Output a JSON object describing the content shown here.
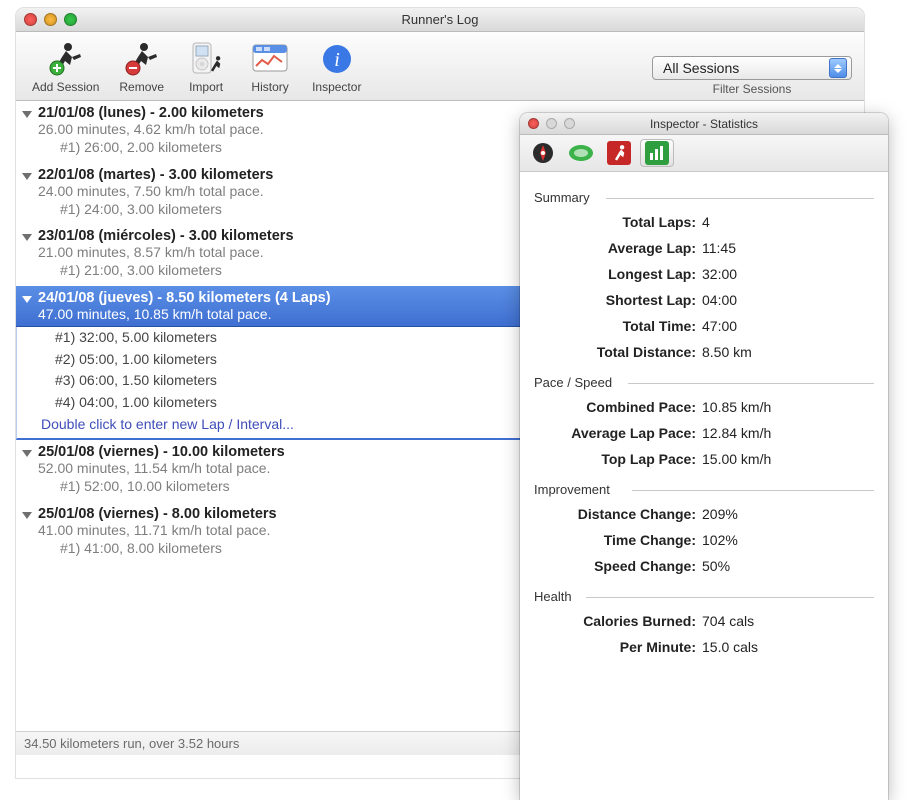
{
  "window": {
    "title": "Runner's Log"
  },
  "toolbar": {
    "add_session": "Add Session",
    "remove": "Remove",
    "import": "Import",
    "history": "History",
    "inspector": "Inspector"
  },
  "filter": {
    "selected": "All Sessions",
    "label": "Filter Sessions"
  },
  "sessions": [
    {
      "title": "21/01/08 (lunes) - 2.00 kilometers",
      "sub": "26.00 minutes, 4.62 km/h total pace.",
      "laps": [
        "#1) 26:00, 2.00 kilometers"
      ]
    },
    {
      "title": "22/01/08 (martes) - 3.00 kilometers",
      "sub": "24.00 minutes, 7.50 km/h total pace.",
      "laps": [
        "#1) 24:00, 3.00 kilometers"
      ]
    },
    {
      "title": "23/01/08 (miércoles) - 3.00 kilometers",
      "sub": "21.00 minutes, 8.57 km/h total pace.",
      "laps": [
        "#1) 21:00, 3.00 kilometers"
      ]
    },
    {
      "title": "24/01/08 (jueves) - 8.50 kilometers (4 Laps)",
      "sub": "47.00 minutes, 10.85 km/h total pace.",
      "laps": [
        "#1) 32:00, 5.00 kilometers",
        "#2) 05:00, 1.00 kilometers",
        "#3) 06:00, 1.50 kilometers",
        "#4) 04:00, 1.00 kilometers"
      ],
      "selected": true,
      "new_lap_hint": "Double click to enter new Lap / Interval..."
    },
    {
      "title": "25/01/08 (viernes) - 10.00 kilometers",
      "sub": "52.00 minutes, 11.54 km/h total pace.",
      "laps": [
        "#1) 52:00, 10.00 kilometers"
      ]
    },
    {
      "title": "25/01/08 (viernes) - 8.00 kilometers",
      "sub": "41.00 minutes, 11.71 km/h total pace.",
      "laps": [
        "#1) 41:00, 8.00 kilometers"
      ]
    }
  ],
  "status_bar": "34.50 kilometers run, over 3.52 hours",
  "inspector": {
    "title": "Inspector - Statistics",
    "groups": {
      "summary_label": "Summary",
      "pace_label": "Pace / Speed",
      "improvement_label": "Improvement",
      "health_label": "Health"
    },
    "stats": {
      "total_laps_label": "Total Laps:",
      "total_laps": "4",
      "avg_lap_label": "Average Lap:",
      "avg_lap": "11:45",
      "longest_lap_label": "Longest Lap:",
      "longest_lap": "32:00",
      "shortest_lap_label": "Shortest Lap:",
      "shortest_lap": "04:00",
      "total_time_label": "Total Time:",
      "total_time": "47:00",
      "total_distance_label": "Total Distance:",
      "total_distance": "8.50 km",
      "combined_pace_label": "Combined Pace:",
      "combined_pace": "10.85 km/h",
      "avg_lap_pace_label": "Average Lap Pace:",
      "avg_lap_pace": "12.84 km/h",
      "top_lap_pace_label": "Top Lap Pace:",
      "top_lap_pace": "15.00 km/h",
      "distance_change_label": "Distance Change:",
      "distance_change": "209%",
      "time_change_label": "Time Change:",
      "time_change": "102%",
      "speed_change_label": "Speed Change:",
      "speed_change": "50%",
      "calories_label": "Calories Burned:",
      "calories": "704 cals",
      "per_minute_label": "Per Minute:",
      "per_minute": "15.0 cals"
    }
  }
}
